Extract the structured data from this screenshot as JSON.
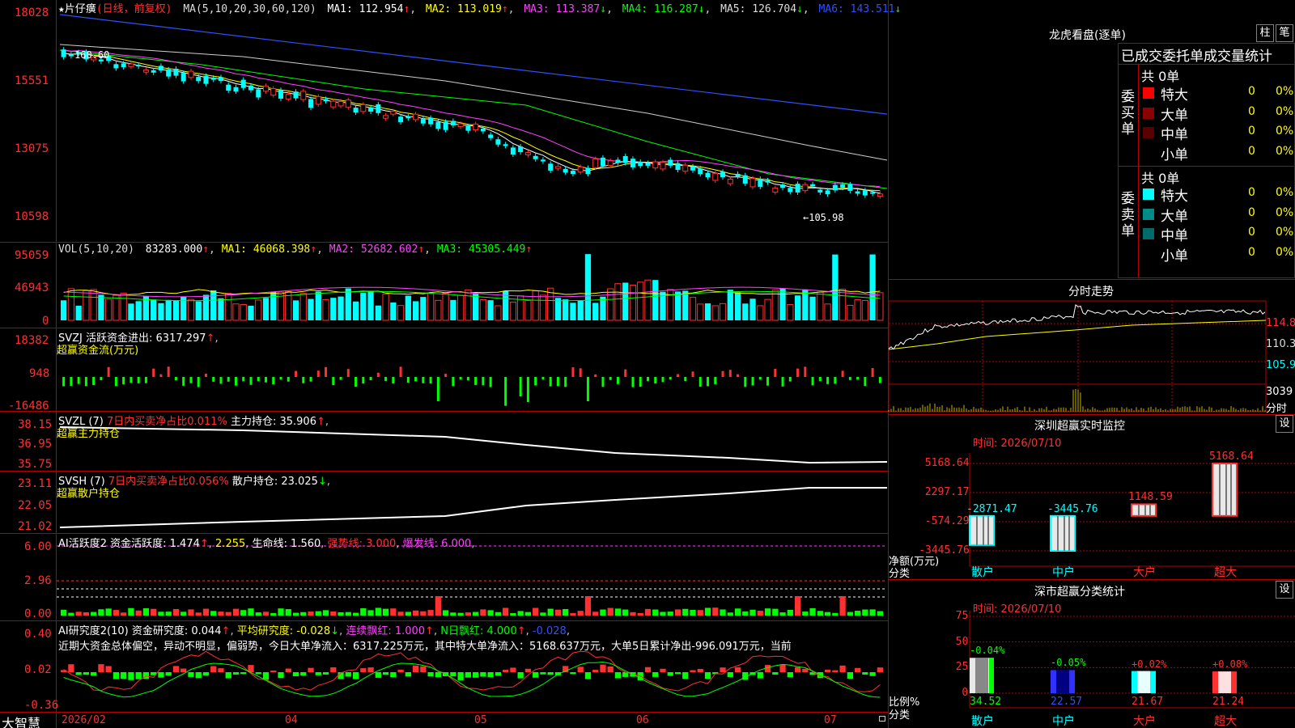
{
  "app": {
    "logo": "大智慧"
  },
  "kline": {
    "title": "★片仔癀",
    "mode": "(日线，前复权)",
    "ma_label": "MA(5,10,20,30,60,120)",
    "ma1": "MA1: 112.954",
    "ma2": "MA2: 113.019",
    "ma3": "MA3: 113.387",
    "ma4": "MA4: 116.287",
    "ma5": "MA5: 126.704",
    "ma6": "MA6: 143.511",
    "high_mark": "160.60",
    "low_mark": "←105.98",
    "axis": [
      "18028",
      "15551",
      "13075",
      "10598"
    ]
  },
  "vol": {
    "label": "VOL(5,10,20)",
    "value": "83283.000",
    "ma1": "MA1: 46068.398",
    "ma2": "MA2: 52682.602",
    "ma3": "MA3: 45305.449",
    "axis": [
      "95059",
      "46943",
      "0"
    ]
  },
  "svzj": {
    "label": "SVZJ 活跃资金进出: 6317.297",
    "sub": "超赢资金流(万元)",
    "axis": [
      "18382",
      "948",
      "-16486"
    ]
  },
  "svzl": {
    "label": "SVZL (7)",
    "ratio": "7日内买卖净占比0.011%",
    "hold": "主力持仓: 35.906",
    "sub": "超赢主力持仓",
    "axis": [
      "38.15",
      "36.95",
      "35.75"
    ]
  },
  "svsh": {
    "label": "SVSH (7)",
    "ratio": "7日内买卖净占比0.056%",
    "hold": "散户持仓: 23.025",
    "sub": "超赢散户持仓",
    "axis": [
      "23.11",
      "22.05",
      "21.02"
    ]
  },
  "ai1": {
    "label": "AI活跃度2 资金活跃度: 1.474",
    "v2": "2.255",
    "life": "生命线: 1.560",
    "strong": "强势线: 3.000",
    "burst": "爆发线: 6.000",
    "axis": [
      "6.00",
      "2.96",
      "0.00"
    ]
  },
  "ai2": {
    "label": "AI研究度2(10) 资金研究度: 0.044",
    "avg": "平均研究度: -0.028",
    "streak": "连续飘红: 1.000",
    "nday": "N日飘红: 4.000",
    "last": "-0.028",
    "comment": "近期大资金总体偏空，异动不明显，偏弱势，今日大单净流入：6317.225万元，其中特大单净流入：5168.637万元，大单5日累计净出-996.091万元，当前",
    "axis": [
      "0.40",
      "0.02",
      "-0.36"
    ]
  },
  "xaxis": [
    "2026/02",
    "04",
    "05",
    "06",
    "07"
  ],
  "lhb": {
    "title": "龙虎看盘(逐单)",
    "btn_bar": "柱",
    "btn_pen": "笔",
    "header": "已成交委托单成交量统计",
    "buy_label": "委买单",
    "sell_label": "委卖单",
    "buy_total": "共 0单",
    "sell_total": "共 0单",
    "buy_rows": [
      {
        "name": "特大",
        "n": "0",
        "p": "0%",
        "color": "#ff0000"
      },
      {
        "name": "大单",
        "n": "0",
        "p": "0%",
        "color": "#8b0000"
      },
      {
        "name": "中单",
        "n": "0",
        "p": "0%",
        "color": "#5a0000"
      },
      {
        "name": "小单",
        "n": "0",
        "p": "0%",
        "color": "#000000"
      }
    ],
    "sell_rows": [
      {
        "name": "特大",
        "n": "0",
        "p": "0%",
        "color": "#00ffff"
      },
      {
        "name": "大单",
        "n": "0",
        "p": "0%",
        "color": "#008b8b"
      },
      {
        "name": "中单",
        "n": "0",
        "p": "0%",
        "color": "#006b6b"
      },
      {
        "name": "小单",
        "n": "0",
        "p": "0%",
        "color": "#000000"
      }
    ]
  },
  "fenshi": {
    "title": "分时走势",
    "axis": [
      "114.8",
      "110.3",
      "105.9",
      "3039",
      "分时"
    ]
  },
  "sz_monitor": {
    "title": "深圳超赢实时监控",
    "btn": "设",
    "time": "时间: 2026/07/10",
    "axis": [
      "5168.64",
      "2297.17",
      "-574.29",
      "-3445.76"
    ],
    "ylabel1": "净额(万元)",
    "ylabel2": "分类",
    "cats": [
      "散户",
      "中户",
      "大户",
      "超大"
    ],
    "values": [
      "-2871.47",
      "-3445.76",
      "1148.59",
      "5168.64"
    ]
  },
  "sz_class": {
    "title": "深市超赢分类统计",
    "btn": "设",
    "time": "时间: 2026/07/10",
    "axis": [
      "75",
      "50",
      "25",
      "0"
    ],
    "ylabel1": "比例%",
    "ylabel2": "分类",
    "cats": [
      "散户",
      "中户",
      "大户",
      "超大"
    ],
    "top": [
      "-0.04%",
      "-0.05%",
      "+0.02%",
      "+0.08%"
    ],
    "bottom": [
      "34.52",
      "22.57",
      "21.67",
      "21.24"
    ]
  }
}
